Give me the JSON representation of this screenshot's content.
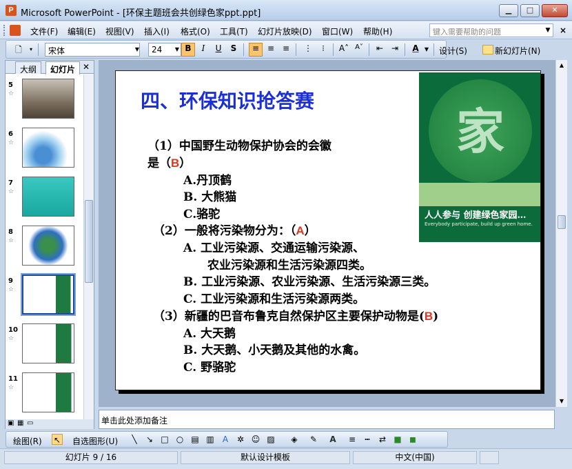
{
  "window": {
    "app_name": "Microsoft PowerPoint",
    "title": "Microsoft PowerPoint - [环保主题班会共创绿色家ppt.ppt]",
    "min": "▁",
    "max": "□",
    "close": "✕"
  },
  "menu": {
    "items": [
      "文件(F)",
      "编辑(E)",
      "视图(V)",
      "插入(I)",
      "格式(O)",
      "工具(T)",
      "幻灯片放映(D)",
      "窗口(W)",
      "帮助(H)"
    ],
    "help_placeholder": "键入需要帮助的问题",
    "close": "×"
  },
  "toolbar": {
    "font_name": "宋体",
    "font_size": "24",
    "bold": "B",
    "italic": "I",
    "underline": "U",
    "shadow": "S",
    "design_label": "设计(S)",
    "new_slide_label": "新幻灯片(N)",
    "bold_active": true,
    "align_left_active": true
  },
  "left_pane": {
    "tabs": [
      "大纲",
      "幻灯片"
    ],
    "active_tab": "幻灯片",
    "tab_close": "✕",
    "slides": [
      {
        "number": "5",
        "selected": false
      },
      {
        "number": "6",
        "selected": false
      },
      {
        "number": "7",
        "selected": false
      },
      {
        "number": "8",
        "selected": false
      },
      {
        "number": "9",
        "selected": true
      },
      {
        "number": "10",
        "selected": false
      },
      {
        "number": "11",
        "selected": false
      }
    ],
    "star": "☆"
  },
  "slide": {
    "title": "四、环保知识抢答赛",
    "q1_line1": "（1）中国野生动物保护协会的会徽",
    "q1_line2_prefix": "是（",
    "q1_answer": "B",
    "q1_line2_suffix": "）",
    "q1_a": "A.丹顶鹤",
    "q1_b": "B. 大熊猫",
    "q1_c": "C.骆驼",
    "q2_line": "（2）一般将污染物分为：（",
    "q2_answer": "A",
    "q2_suffix": "）",
    "q2_a1": "A.  工业污染源、交通运输污染源、",
    "q2_a2": "农业污染源和生活污染源四类。",
    "q2_b": "B. 工业污染源、农业污染源、生活污染源三类。",
    "q2_c": "C. 工业污染源和生活污染源两类。",
    "q3_line": "（3）新疆的巴音布鲁克自然保护区主要保护动物是(",
    "q3_answer": "B",
    "q3_suffix": ")",
    "q3_a": "A. 大天鹅",
    "q3_b": "B. 大天鹅、小天鹅及其他的水禽。",
    "q3_c": "C.  野骆驼",
    "image_char": "家",
    "image_caption": "人人参与 创建绿色家园…",
    "image_subcaption": "Everybody participate, build up green home."
  },
  "notes": {
    "placeholder": "单击此处添加备注"
  },
  "drawing_toolbar": {
    "draw_label": "绘图(R)",
    "autoshapes_label": "自选图形(U)"
  },
  "status": {
    "slide_info": "幻灯片 9 / 16",
    "template": "默认设计模板",
    "language": "中文(中国)"
  },
  "colors": {
    "title_blue": "#1a2fd6",
    "answer_red": "#e2361f",
    "selected_border": "#1c4a9c"
  }
}
